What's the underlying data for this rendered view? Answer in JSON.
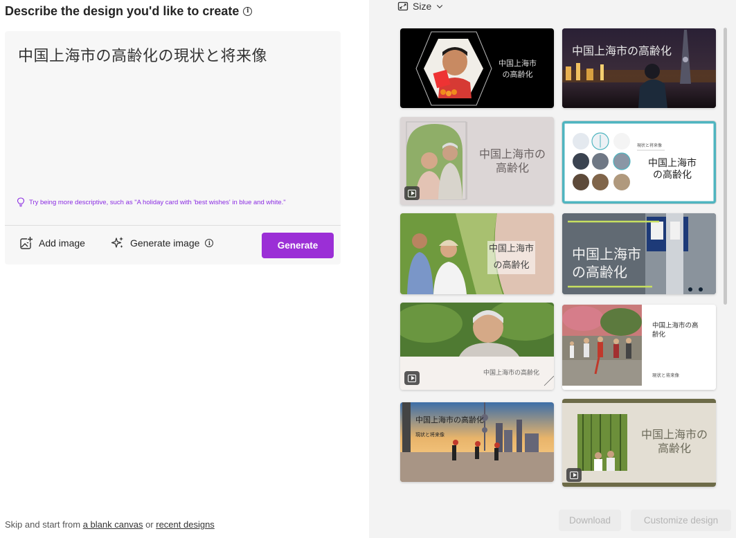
{
  "left": {
    "heading": "Describe the design you'd like to create",
    "prompt": "中国上海市の高齢化の現状と将来像",
    "tip": "Try being more descriptive, such as \"A holiday card with 'best wishes' in blue and white.\"",
    "add_image": "Add image",
    "generate_image": "Generate image",
    "generate": "Generate",
    "footer": {
      "prefix": "Skip and start from ",
      "blank_canvas": "a blank canvas",
      "middle": " or ",
      "recent_designs": "recent designs"
    }
  },
  "right": {
    "size_label": "Size",
    "download": "Download",
    "customize": "Customize design",
    "designs": [
      {
        "id": "d1",
        "title_line1": "中国上海市",
        "title_line2": "の高齢化",
        "selected": false,
        "video": false
      },
      {
        "id": "d2",
        "title": "中国上海市の高齢化",
        "selected": false,
        "video": false
      },
      {
        "id": "d3",
        "title_line1": "中国上海市の",
        "title_line2": "高齢化",
        "selected": false,
        "video": true
      },
      {
        "id": "d4",
        "small": "現状と将来像",
        "title_line1": "中国上海市",
        "title_line2": "の高齢化",
        "selected": true,
        "video": false
      },
      {
        "id": "d5",
        "title_line1": "中国上海市",
        "title_line2": "の高齢化",
        "selected": false,
        "video": false
      },
      {
        "id": "d6",
        "title_line1": "中国上海市",
        "title_line2": "の高齢化",
        "selected": false,
        "video": false
      },
      {
        "id": "d7",
        "title": "中国上海市の高齢化",
        "selected": false,
        "video": true
      },
      {
        "id": "d8",
        "title_line1": "中国上海市の高",
        "title_line2": "齢化",
        "small": "現状と将来像",
        "selected": false,
        "video": false
      },
      {
        "id": "d9",
        "title": "中国上海市の高齢化",
        "small": "現状と将来像",
        "selected": false,
        "video": false
      },
      {
        "id": "d10",
        "title_line1": "中国上海市の",
        "title_line2": "高齢化",
        "selected": false,
        "video": true
      }
    ]
  },
  "colors": {
    "accent": "#9b2fd6",
    "tip_text": "#8a2be2",
    "selected_border": "#4fb5c0",
    "right_bg": "#f3f3f3"
  }
}
